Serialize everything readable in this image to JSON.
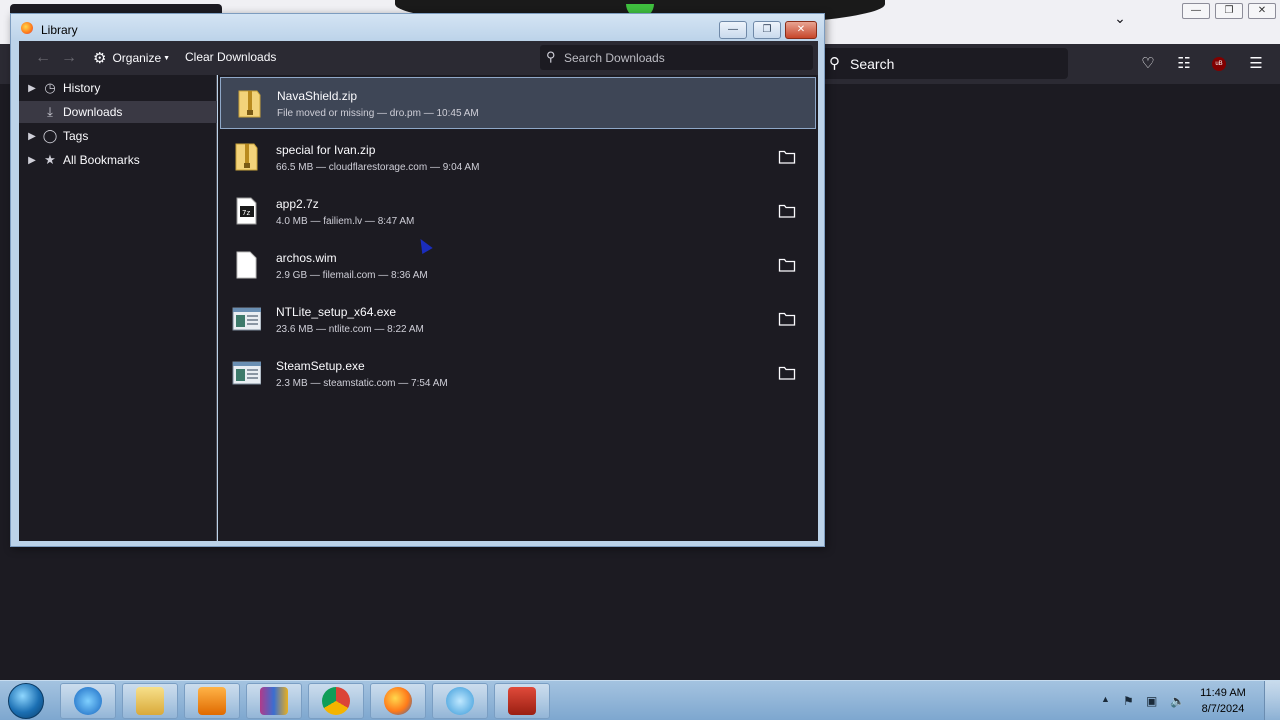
{
  "browser": {
    "search_placeholder": "Search",
    "colors": {
      "toolbar": "#2b2a33",
      "content": "#1c1b22",
      "ublock": "#800000"
    },
    "ublock_label": "uB"
  },
  "library": {
    "title": "Library",
    "toolbar": {
      "organize_label": "Organize",
      "clear_label": "Clear Downloads",
      "search_placeholder": "Search Downloads"
    },
    "sidebar": [
      {
        "label": "History",
        "icon": "clock-icon",
        "selected": false,
        "expandable": true
      },
      {
        "label": "Downloads",
        "icon": "download-icon",
        "selected": true,
        "expandable": false
      },
      {
        "label": "Tags",
        "icon": "tag-icon",
        "selected": false,
        "expandable": true
      },
      {
        "label": "All Bookmarks",
        "icon": "star-icon",
        "selected": false,
        "expandable": true
      }
    ],
    "downloads": [
      {
        "name": "NavaShield.zip",
        "meta": "File moved or missing — dro.pm — 10:45 AM",
        "icon": "zip-icon",
        "selected": true,
        "folder": false
      },
      {
        "name": "special for Ivan.zip",
        "meta": "66.5 MB — cloudflarestorage.com — 9:04 AM",
        "icon": "zip-icon",
        "selected": false,
        "folder": true
      },
      {
        "name": "app2.7z",
        "meta": "4.0 MB — failiem.lv — 8:47 AM",
        "icon": "7z-icon",
        "selected": false,
        "folder": true
      },
      {
        "name": "archos.wim",
        "meta": "2.9 GB — filemail.com — 8:36 AM",
        "icon": "blank-file-icon",
        "selected": false,
        "folder": true
      },
      {
        "name": "NTLite_setup_x64.exe",
        "meta": "23.6 MB — ntlite.com — 8:22 AM",
        "icon": "exe-icon",
        "selected": false,
        "folder": true
      },
      {
        "name": "SteamSetup.exe",
        "meta": "2.3 MB — steamstatic.com — 7:54 AM",
        "icon": "exe-icon",
        "selected": false,
        "folder": true
      }
    ]
  },
  "taskbar": {
    "time": "11:49 AM",
    "date": "8/7/2024",
    "apps": [
      "internet-explorer-icon",
      "file-explorer-icon",
      "media-player-icon",
      "winrar-icon",
      "chrome-icon",
      "firefox-icon",
      "bubble-app-icon",
      "toolbox-app-icon"
    ]
  }
}
